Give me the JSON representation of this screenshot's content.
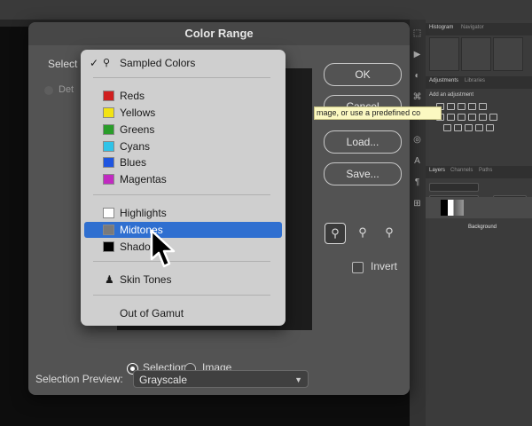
{
  "background": {
    "panels": {
      "histogram_tab": "Histogram",
      "navigator_tab": "Navigator",
      "adjustments_tab": "Adjustments",
      "libraries_tab": "Libraries",
      "add_adjustment": "Add an adjustment",
      "layers_tab": "Layers",
      "channels_tab": "Channels",
      "paths_tab": "Paths",
      "layer_name": "Background"
    }
  },
  "dialog": {
    "title": "Color Range",
    "select_label": "Select",
    "detect_label": "Det",
    "ok_label": "OK",
    "cancel_label": "Cancel",
    "load_label": "Load...",
    "save_label": "Save...",
    "tooltip": "mage, or use a predefined co",
    "invert_label": "Invert",
    "radio_selection": "Selection",
    "radio_image": "Image",
    "selection_preview_label": "Selection Preview:",
    "selection_preview_value": "Grayscale"
  },
  "menu": {
    "sampled": "Sampled Colors",
    "items": [
      {
        "label": "Reds",
        "color": "#d01f1f"
      },
      {
        "label": "Yellows",
        "color": "#f2e313"
      },
      {
        "label": "Greens",
        "color": "#2a9d2a"
      },
      {
        "label": "Cyans",
        "color": "#2fc3e8"
      },
      {
        "label": "Blues",
        "color": "#1f55e0"
      },
      {
        "label": "Magentas",
        "color": "#c12ac1"
      }
    ],
    "tones": [
      {
        "label": "Highlights",
        "color": "#ffffff"
      },
      {
        "label": "Midtones",
        "color": "#7a7a7a"
      },
      {
        "label": "Shado",
        "color": "#000000"
      }
    ],
    "skin_tones": "Skin Tones",
    "out_of_gamut": "Out of Gamut",
    "highlight_color": "#2f6fd0"
  },
  "icons": [
    "check-icon",
    "eyedropper-icon",
    "person-icon",
    "mouse-pointer-icon",
    "chevron-down-icon"
  ]
}
